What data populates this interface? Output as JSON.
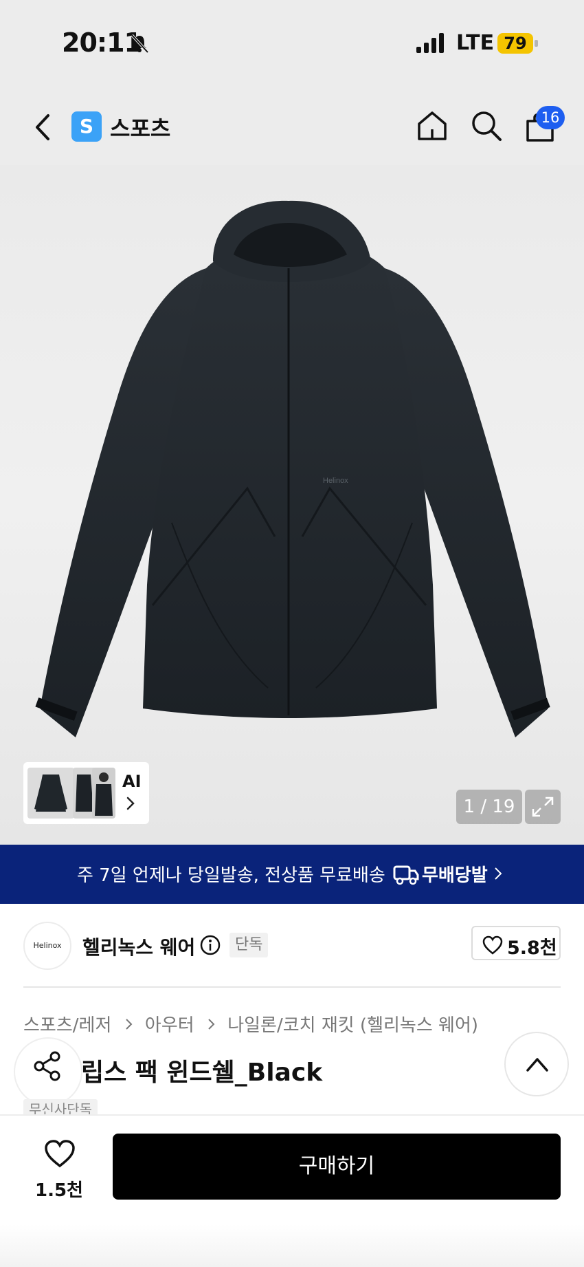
{
  "status_bar": {
    "time": "20:11",
    "network": "LTE",
    "battery": "79"
  },
  "nav": {
    "store_logo": "S",
    "store_name": "스포츠",
    "cart_count": "16"
  },
  "gallery": {
    "ai_label": "AI",
    "counter": "1 / 19",
    "image_print": "Helinox"
  },
  "promo": {
    "text": "주 7일 언제나 당일발송, 전상품 무료배송",
    "brand": "무배당발"
  },
  "brand": {
    "logo_text": "Helinox",
    "name": "헬리녹스 웨어",
    "exclusive_tag": "단독",
    "like_count": "5.8천"
  },
  "breadcrumb": [
    "스포츠/레저",
    "아우터",
    "나일론/코치 재킷 (헬리녹스 웨어)"
  ],
  "product": {
    "title": "립스 팩 윈드쉘_Black",
    "badge": "무신사단독"
  },
  "bottom": {
    "wish_count": "1.5천",
    "buy_label": "구매하기"
  },
  "colors": {
    "promo_bg": "#0a237a",
    "cart_badge": "#1e5ef0",
    "battery": "#f4c400",
    "store_logo": "#3ba2f7",
    "buy_button": "#000000"
  },
  "icons": [
    "bell-off-icon",
    "signal-icon",
    "back-icon",
    "home-icon",
    "search-icon",
    "cart-icon",
    "chevron-right-icon",
    "expand-icon",
    "truck-icon",
    "info-icon",
    "heart-icon",
    "share-icon",
    "chevron-up-icon"
  ]
}
